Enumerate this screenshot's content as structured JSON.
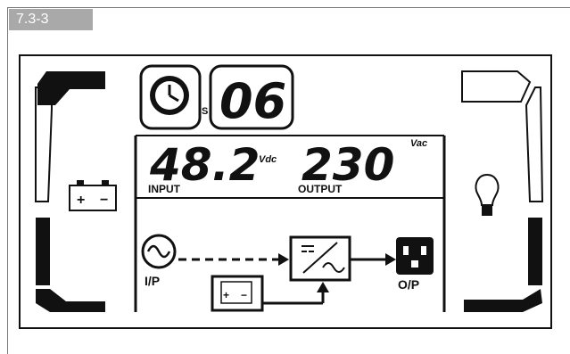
{
  "section": {
    "tab_label": "7.3-3"
  },
  "display": {
    "backup_seconds": {
      "unit": "S",
      "value": "06"
    },
    "input": {
      "value": "48.2",
      "unit": "Vdc",
      "label": "INPUT"
    },
    "output": {
      "value": "230",
      "unit": "Vac",
      "label": "OUTPUT"
    },
    "flow": {
      "input_label": "I/P",
      "output_label": "O/P"
    }
  },
  "icons": [
    "clock-icon",
    "battery-icon",
    "bulb-icon",
    "ac-source-icon",
    "inverter-icon",
    "outlet-icon"
  ],
  "colors": {
    "lcd_ink": "#111111",
    "tab_bg": "#a9a9a9",
    "frame": "#7a7a7a"
  }
}
